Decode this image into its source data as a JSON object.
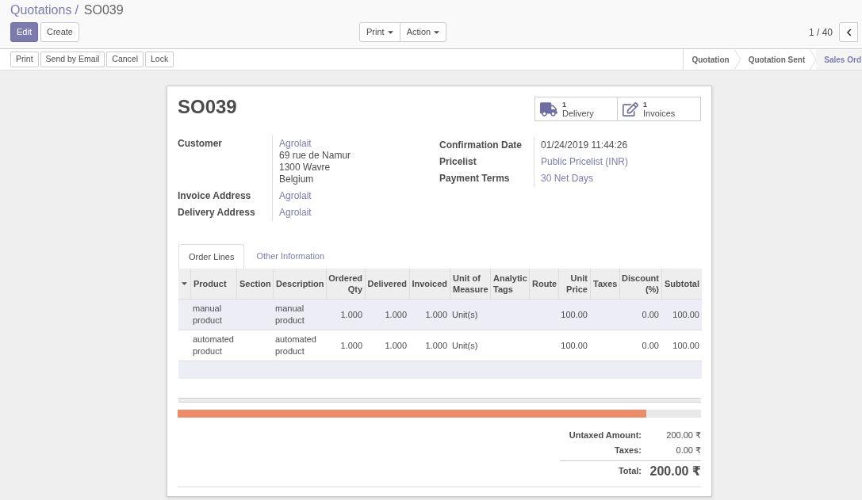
{
  "breadcrumb": {
    "parent": "Quotations",
    "separator": "/",
    "current": "SO039"
  },
  "control_buttons": [
    {
      "label": "Edit",
      "kind": "primary"
    },
    {
      "label": "Create",
      "kind": "default"
    }
  ],
  "sidebar_menus": [
    {
      "label": "Print"
    },
    {
      "label": "Action"
    }
  ],
  "pager": {
    "text": "1 / 40"
  },
  "status_buttons": [
    "Print",
    "Send by Email",
    "Cancel",
    "Lock"
  ],
  "status_steps": [
    {
      "label": "Quotation",
      "selected": false
    },
    {
      "label": "Quotation Sent",
      "selected": false
    },
    {
      "label": "Sales Ord",
      "selected": true
    }
  ],
  "sheet": {
    "title": "SO039",
    "smart_buttons": [
      {
        "kind": "delivery",
        "count": "1",
        "label": "Delivery"
      },
      {
        "kind": "invoices",
        "count": "1",
        "label": "Invoices"
      }
    ],
    "fields_left": [
      {
        "label": "Customer",
        "kind": "link",
        "value": "Agrolait",
        "address": [
          "69 rue de Namur",
          "1300 Wavre",
          "Belgium"
        ]
      },
      {
        "label": "Invoice Address",
        "kind": "link",
        "value": "Agrolait"
      },
      {
        "label": "Delivery Address",
        "kind": "link",
        "value": "Agrolait"
      }
    ],
    "fields_right": [
      {
        "label": "Confirmation Date",
        "kind": "text",
        "value": "01/24/2019 11:44:26"
      },
      {
        "label": "Pricelist",
        "kind": "link",
        "value": "Public Pricelist (INR)"
      },
      {
        "label": "Payment Terms",
        "kind": "link",
        "value": "30 Net Days"
      }
    ],
    "tabs": [
      {
        "label": "Order Lines",
        "selected": true
      },
      {
        "label": "Other Information",
        "selected": false
      }
    ],
    "table": {
      "columns": [
        {
          "label": "Product",
          "kind": "text"
        },
        {
          "label": "Section",
          "kind": "text"
        },
        {
          "label": "Description",
          "kind": "text"
        },
        {
          "label": "Ordered Qty",
          "kind": "number"
        },
        {
          "label": "Delivered",
          "kind": "number"
        },
        {
          "label": "Invoiced",
          "kind": "number"
        },
        {
          "label": "Unit of Measure",
          "kind": "text"
        },
        {
          "label": "Analytic Tags",
          "kind": "text"
        },
        {
          "label": "Route",
          "kind": "text"
        },
        {
          "label": "Unit Price",
          "kind": "number"
        },
        {
          "label": "Taxes",
          "kind": "text"
        },
        {
          "label": "Discount (%)",
          "kind": "number"
        },
        {
          "label": "Subtotal",
          "kind": "number"
        }
      ],
      "rows": [
        {
          "selected": true,
          "cells": [
            "manual product",
            null,
            "manual product",
            "1.000",
            "1.000",
            "1.000",
            "Unit(s)",
            null,
            null,
            "100.00",
            null,
            "0.00",
            "100.00"
          ]
        },
        {
          "selected": false,
          "cells": [
            "automated product",
            null,
            "automated product",
            "1.000",
            "1.000",
            "1.000",
            "Unit(s)",
            null,
            null,
            "100.00",
            null,
            "0.00",
            "100.00"
          ]
        }
      ]
    },
    "totals": [
      {
        "kind": "line",
        "label": "Untaxed Amount:",
        "value": "200.00 ₹"
      },
      {
        "kind": "line",
        "label": "Taxes:",
        "value": "0.00 ₹"
      },
      {
        "kind": "total",
        "label": "Total:",
        "value": "200.00 ₹"
      }
    ]
  }
}
